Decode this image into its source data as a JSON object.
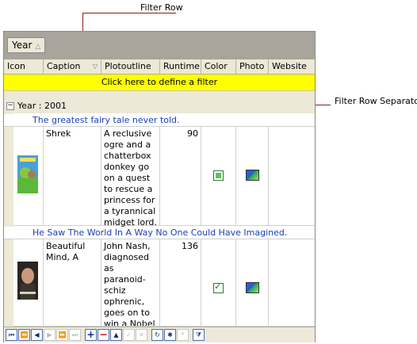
{
  "callouts": {
    "filter_row": "Filter Row",
    "filter_row_separator": "Filter Row Separator"
  },
  "group_panel": {
    "chip_label": "Year",
    "chip_arrow": "△"
  },
  "columns": [
    {
      "label": "Icon"
    },
    {
      "label": "Caption",
      "filter_arrow": "▽"
    },
    {
      "label": "Plotoutline"
    },
    {
      "label": "Runtime"
    },
    {
      "label": "Color"
    },
    {
      "label": "Photo"
    },
    {
      "label": "Website"
    }
  ],
  "filter_row": {
    "text": "Click here to define a filter"
  },
  "group_row": {
    "toggle": "−",
    "text": "Year : 2001"
  },
  "records": [
    {
      "tagline": "The greatest fairy tale never told.",
      "caption": "Shrek",
      "plot": "A reclusive ogre and a chatterbox donkey go on a quest to rescue a princess for a tyrannical midget lord.",
      "runtime": "90",
      "color_state": "indeterminate",
      "poster_icon": "shrek-poster"
    },
    {
      "tagline": "He Saw The World In A Way No One Could Have Imagined.",
      "caption": "Beautiful Mind, A",
      "plot": "John Nash, diagnosed as paranoid-schiz ophrenic, goes on to win a Nobel Prize for work on game theory.",
      "runtime": "136",
      "color_state": "checked",
      "poster_icon": "beautiful-mind-poster"
    }
  ],
  "navigator": {
    "buttons": [
      "⏮",
      "⏪",
      "◀",
      "▶",
      "⏩",
      "⏭",
      "+",
      "−",
      "▲",
      "✓",
      "✕",
      "↻",
      "✱",
      "*",
      "⧩"
    ]
  },
  "colors": {
    "filter_row": "#ffff00",
    "callout": "#8b1a1a",
    "tagline": "#1a3eb8"
  }
}
